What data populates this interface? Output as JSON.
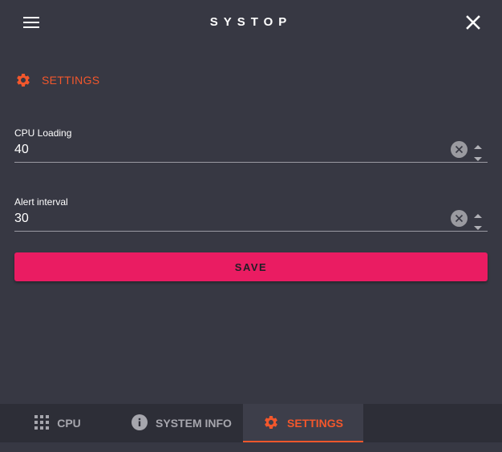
{
  "header": {
    "title": "SYSTOP",
    "menu_icon": "hamburger-menu-icon",
    "close_icon": "close-icon"
  },
  "section": {
    "icon": "gear-icon",
    "title": "SETTINGS"
  },
  "fields": [
    {
      "label": "CPU Loading",
      "value": "40"
    },
    {
      "label": "Alert interval",
      "value": "30"
    }
  ],
  "save_label": "SAVE",
  "bottom_nav": {
    "items": [
      {
        "label": "CPU",
        "icon": "grid-icon",
        "active": false
      },
      {
        "label": "SYSTEM INFO",
        "icon": "info-icon",
        "active": false
      },
      {
        "label": "SETTINGS",
        "icon": "gear-icon",
        "active": true
      }
    ]
  },
  "colors": {
    "background": "#373843",
    "accent": "#f2572c",
    "save_button": "#ea1c62",
    "nav_background": "#2d2e37"
  }
}
